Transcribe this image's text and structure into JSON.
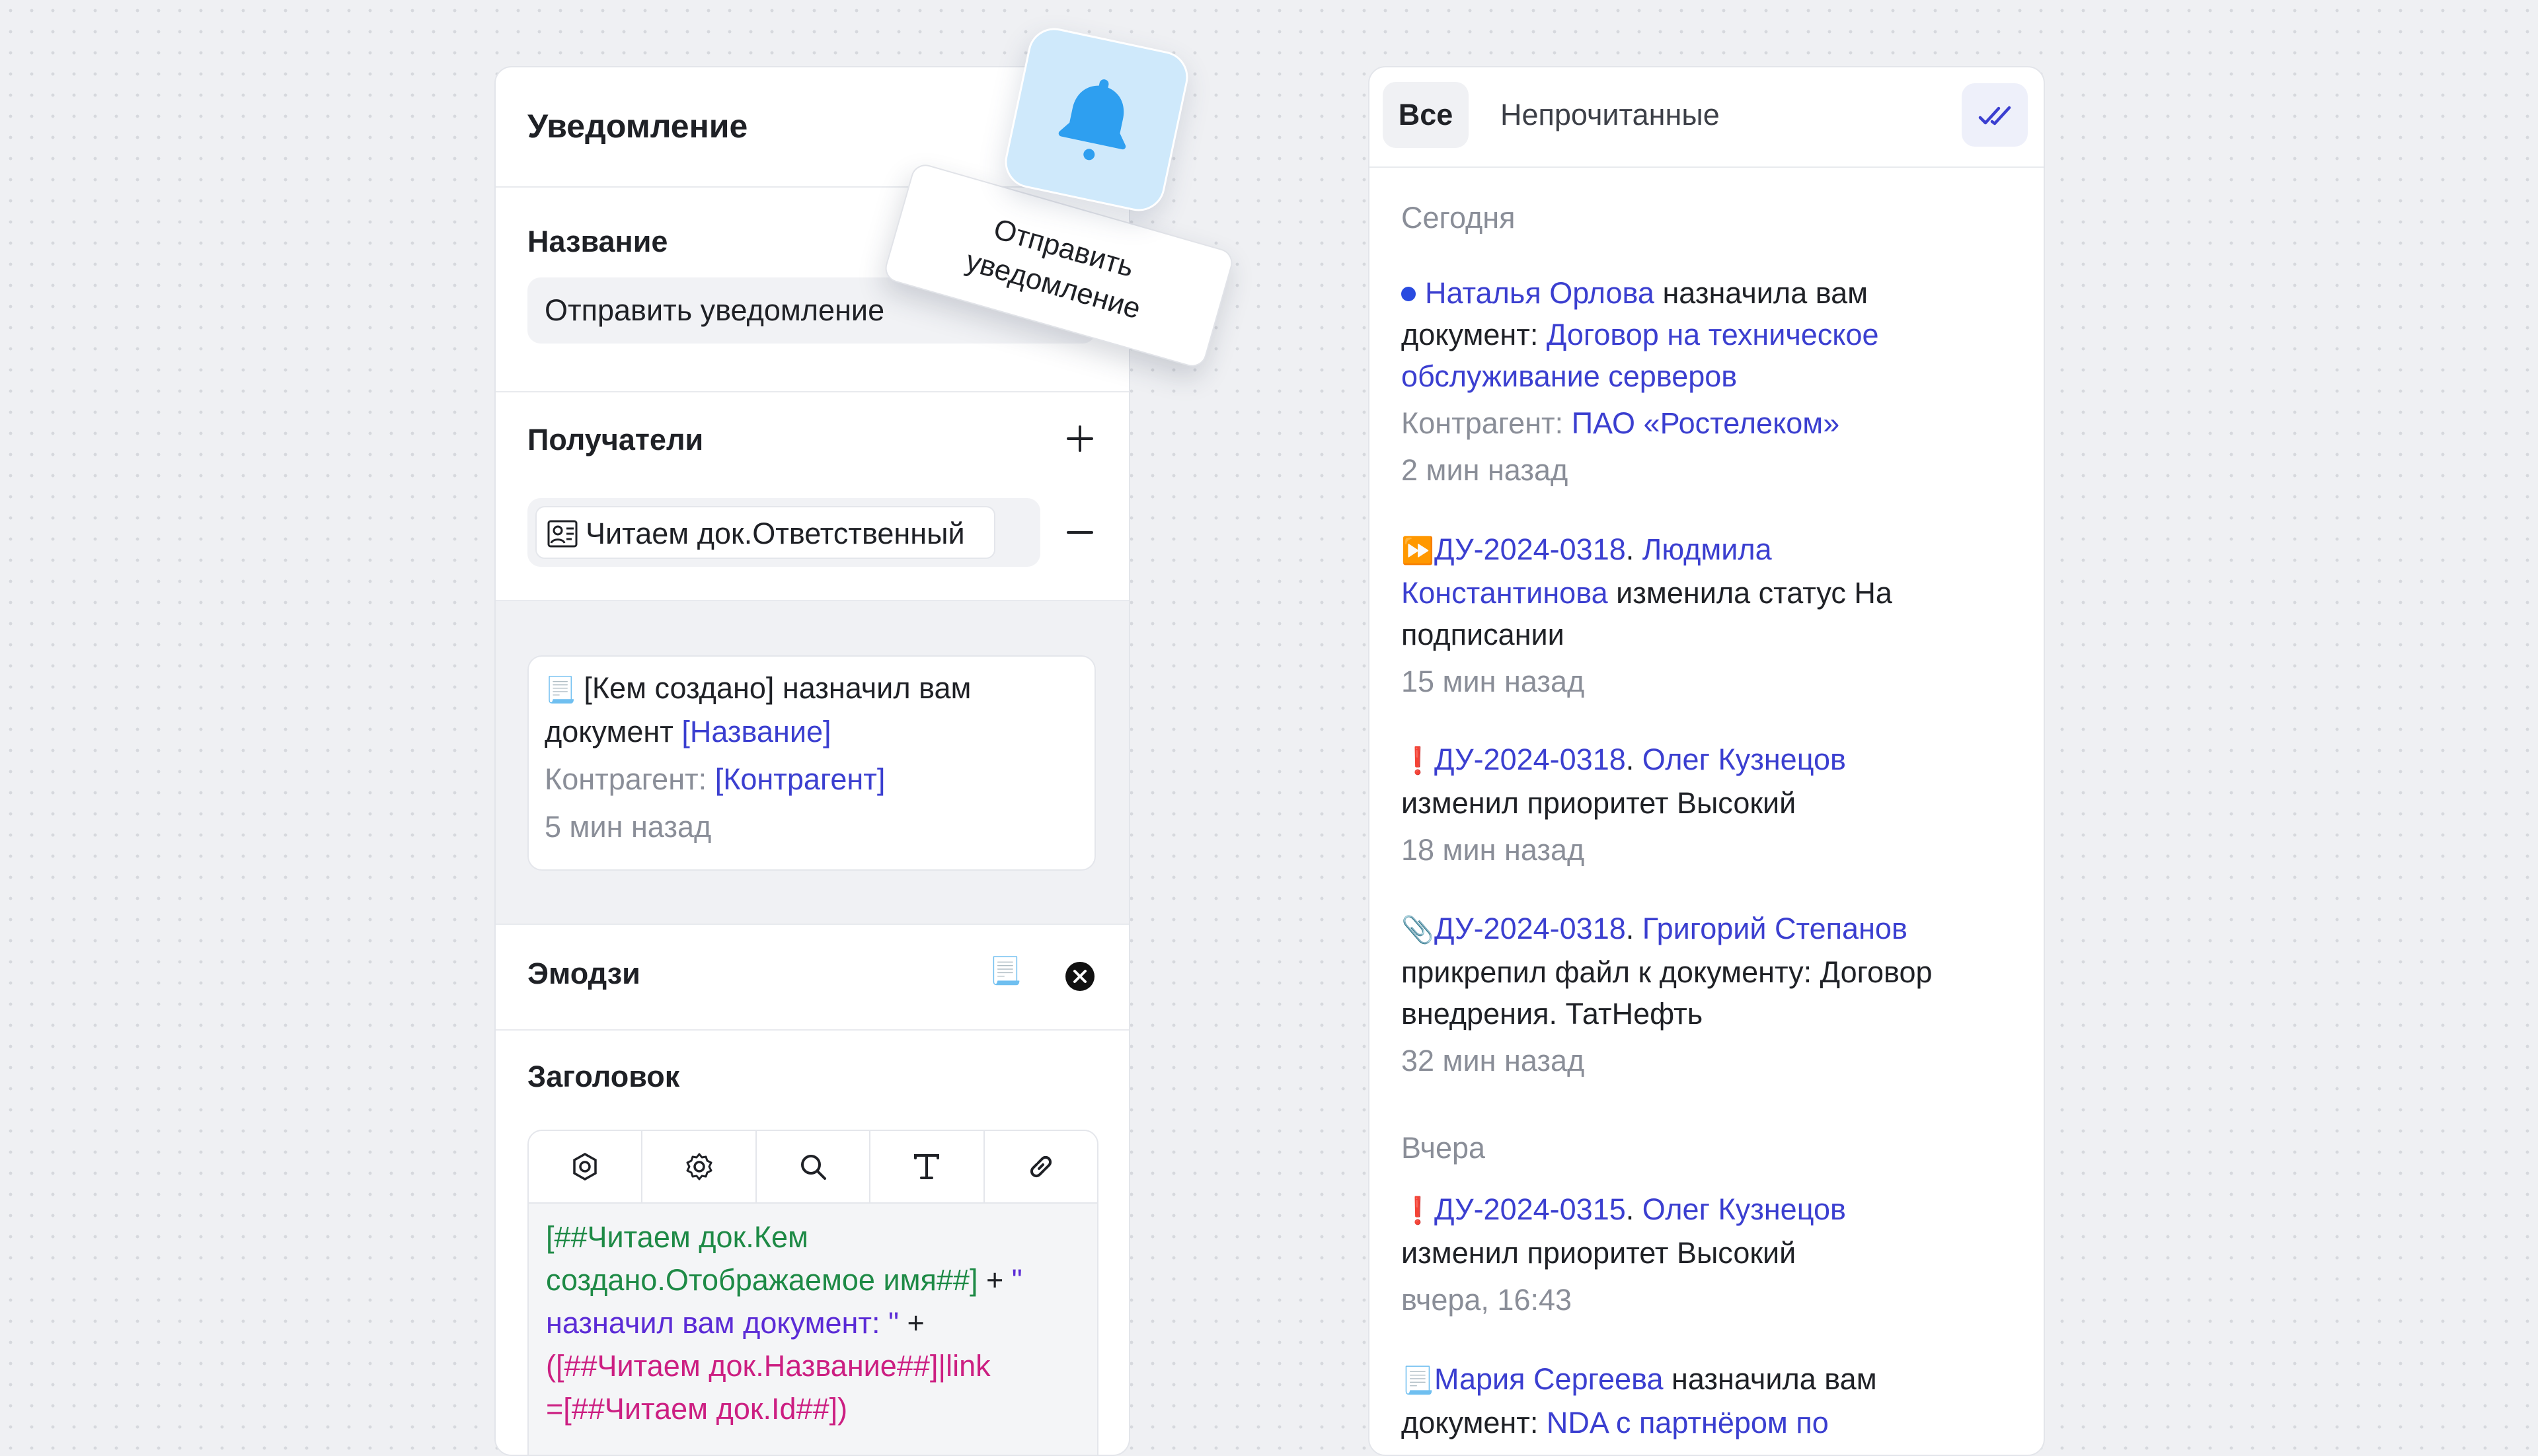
{
  "notification_panel": {
    "title": "Уведомление",
    "name_label": "Название",
    "name_value": "Отправить уведомление",
    "recipients_label": "Получатели",
    "recipient_chip": "Читаем док.Ответственный",
    "preview": {
      "emoji": "📃",
      "line1": "[Кем создано] назначил вам",
      "line2_text": "документ ",
      "line2_link": "[Название]",
      "line3_label": "Контрагент: ",
      "line3_link": "[Контрагент]",
      "time": "5 мин назад"
    },
    "emoji_label": "Эмодзи",
    "emoji_value": "📃",
    "header_label": "Заголовок",
    "toolbar_icons": [
      "component-icon",
      "settings-icon",
      "search-icon",
      "text-icon",
      "link-icon"
    ],
    "code": {
      "l1": "[##Читаем док.Кем",
      "l2a": "создано.Отображаемое имя##]",
      "l2b": " + ",
      "l2c": "\"",
      "l3a": "назначил вам документ: \"",
      "l3b": " +",
      "l4": "([##Читаем док.Название##]|link",
      "l5": "=[##Читаем док.Id##])"
    }
  },
  "send_tag": {
    "line1": "Отправить",
    "line2": "уведомление"
  },
  "feed": {
    "tabs": {
      "all": "Все",
      "unread": "Непрочитанные"
    },
    "today_label": "Сегодня",
    "yesterday_label": "Вчера",
    "items": [
      {
        "icon": "unread-dot",
        "actor": "Наталья Орлова",
        "text1": " назначила вам",
        "text2": "документ: ",
        "doc_link1": "Договор на техническое",
        "doc_link2": "обслуживание серверов",
        "meta_label": "Контрагент: ",
        "meta_link": "ПАО «Ростелеком»",
        "time": "2 мин назад"
      },
      {
        "emoji": "⏩",
        "doc": "ДУ-2024-0318",
        "sep": ". ",
        "actor1": "Людмила",
        "actor2": "Константинова",
        "text1": " изменила статус На",
        "text2": "подписании",
        "time": "15 мин назад"
      },
      {
        "emoji": "❗",
        "doc": "ДУ-2024-0318",
        "sep": ". ",
        "actor": "Олег Кузнецов",
        "text": "изменил приоритет Высокий",
        "time": "18 мин назад"
      },
      {
        "emoji": "📎",
        "doc": "ДУ-2024-0318",
        "sep": ". ",
        "actor": "Григорий Степанов",
        "text1": "прикрепил файл к документу: Договор",
        "text2": "внедрения. ТатНефть",
        "time": "32 мин назад"
      },
      {
        "emoji": "❗",
        "doc": "ДУ-2024-0315",
        "sep": ". ",
        "actor": "Олег Кузнецов",
        "text": "изменил приоритет Высокий",
        "time": "вчера, 16:43"
      },
      {
        "emoji": "📃",
        "actor": "Мария Сергеева",
        "text1": " назначила вам",
        "text2": "документ: ",
        "doc_link": "NDA с партнёром по"
      }
    ]
  }
}
